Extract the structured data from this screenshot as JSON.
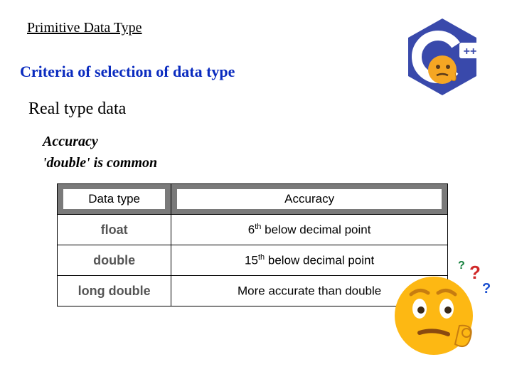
{
  "header": {
    "topic": "Primitive Data Type",
    "criteria": "Criteria of selection of data type",
    "real": "Real type data",
    "accuracy": "Accuracy",
    "double_common": "'double' is common"
  },
  "table": {
    "head_type": "Data type",
    "head_acc": "Accuracy",
    "rows": [
      {
        "type": "float",
        "acc_pre": "6",
        "acc_sup": "th",
        "acc_post": " below decimal point"
      },
      {
        "type": "double",
        "acc_pre": "15",
        "acc_sup": "th",
        "acc_post": " below decimal point"
      },
      {
        "type": "long double",
        "acc_pre": "More accurate than double",
        "acc_sup": "",
        "acc_post": ""
      }
    ]
  },
  "icons": {
    "cpp": "++",
    "cpp_name": "cpp-logo-icon",
    "emoji_name": "thinking-emoji-icon"
  }
}
